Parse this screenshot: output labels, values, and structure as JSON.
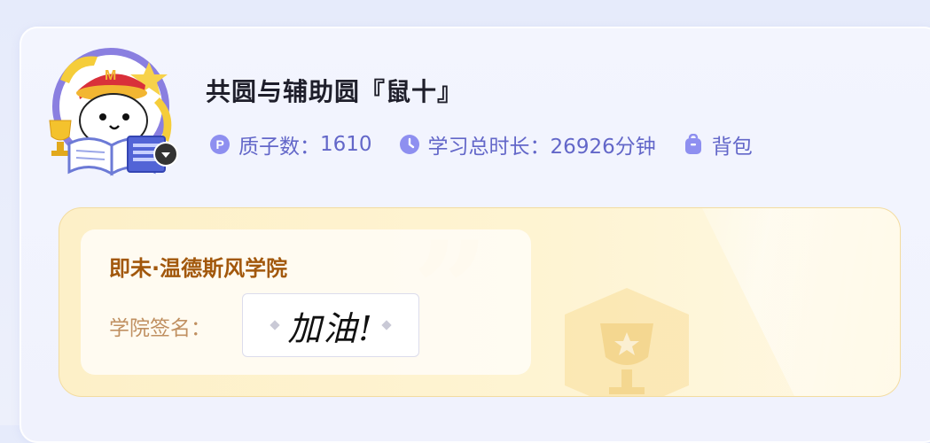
{
  "profile": {
    "username": "共圆与辅助圆『鼠十』",
    "avatar_name": "avatar",
    "stats": {
      "particles_label": "质子数：",
      "particles_value": "1610",
      "study_label": "学习总时长：",
      "study_value": "26926分钟",
      "bag_label": "背包"
    }
  },
  "academy": {
    "name": "即未·温德斯风学院",
    "signature_label": "学院签名：",
    "signature_text": "加油!"
  },
  "colors": {
    "accent": "#6367c9",
    "academy_title": "#a2580c",
    "academy_label": "#c09061",
    "panel_bg": "#fdf0c8"
  },
  "icons": {
    "particles": "p-coin-icon",
    "study": "clock-icon",
    "bag": "backpack-icon",
    "badge": "chevron-down-icon"
  }
}
